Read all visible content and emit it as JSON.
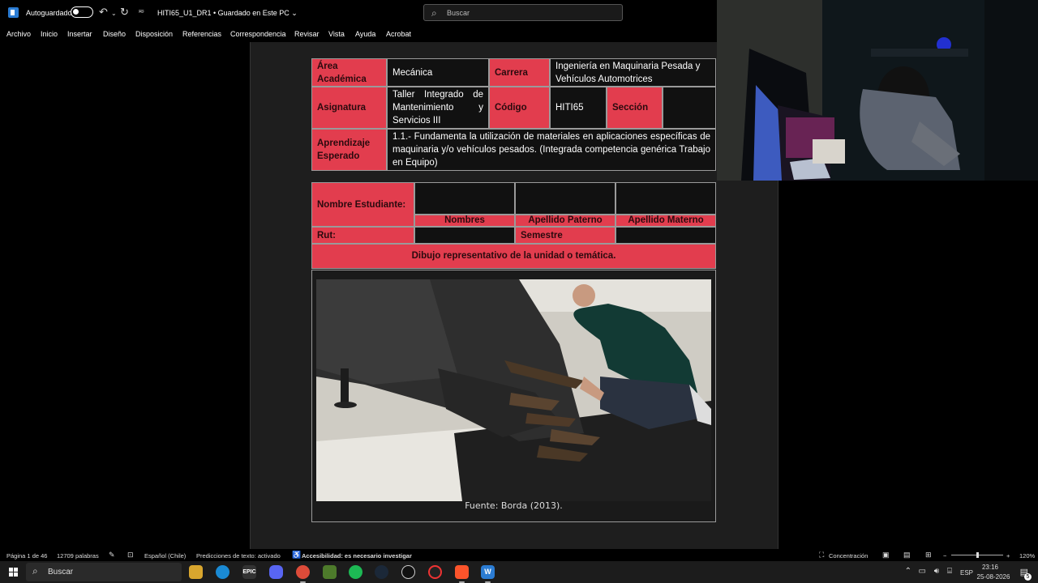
{
  "titlebar": {
    "autosave_label": "Autoguardado",
    "doc_title": "HITI65_U1_DR1 • Guardado en Este PC ⌄",
    "search_placeholder": "Buscar"
  },
  "menu": [
    "Archivo",
    "Inicio",
    "Insertar",
    "Diseño",
    "Disposición",
    "Referencias",
    "Correspondencia",
    "Revisar",
    "Vista",
    "Ayuda",
    "Acrobat"
  ],
  "table1": {
    "area_label": "Área Académica",
    "area_value": "Mecánica",
    "carrera_label": "Carrera",
    "carrera_value": "Ingeniería en Maquinaria Pesada y Vehículos Automotrices",
    "asignatura_label": "Asignatura",
    "asignatura_value": "Taller Integrado de Mantenimiento y Servicios III",
    "codigo_label": "Código",
    "codigo_value": "HITI65",
    "seccion_label": "Sección",
    "seccion_value": "",
    "aprendizaje_label": "Aprendizaje Esperado",
    "aprendizaje_value": "1.1.- Fundamenta la utilización de materiales en aplicaciones específicas de maquinaria y/o vehículos pesados. (Integrada competencia genérica Trabajo en Equipo)"
  },
  "table2": {
    "nombre_label": "Nombre Estudiante:",
    "nombres_header": "Nombres",
    "paterno_header": "Apellido Paterno",
    "materno_header": "Apellido Materno",
    "rut_label": "Rut:",
    "semestre_label": "Semestre",
    "dibujo_label": "Dibujo representativo de la unidad o temática."
  },
  "figure": {
    "caption": "Fuente: Borda (2013)."
  },
  "statusbar": {
    "page": "Página 1 de 46",
    "words": "12709 palabras",
    "language": "Español (Chile)",
    "predictions": "Predicciones de texto: activado",
    "accessibility": "Accesibilidad: es necesario investigar",
    "focus": "Concentración",
    "zoom": "120%",
    "zoom_level": 0.5
  },
  "taskbar": {
    "search": "Buscar",
    "lang": "ESP",
    "time": "23:16",
    "date": "25-08-2026",
    "notif_count": "5"
  },
  "colors": {
    "accent_red": "#e23d4e",
    "word_blue": "#2b7cd3"
  }
}
